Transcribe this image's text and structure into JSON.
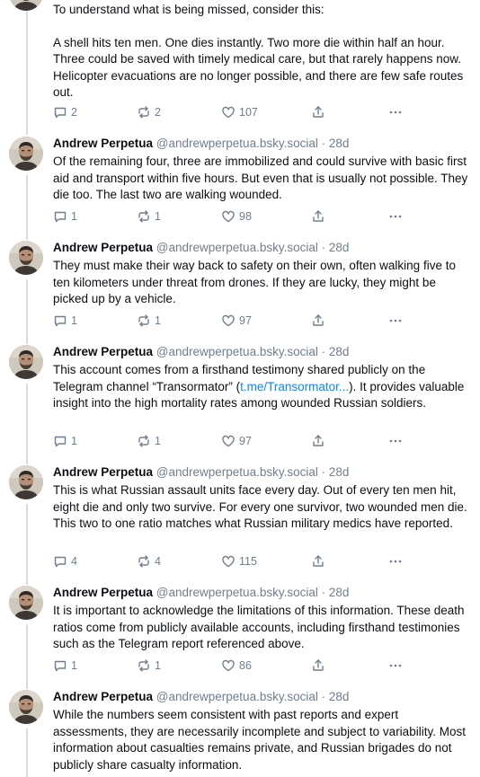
{
  "thread": {
    "first_post": {
      "text_1": "To understand what is being missed, consider this:",
      "text_2": "A shell hits ten men. One dies instantly. Two more die within half an hour. Three could be saved with timely medical care, but that rarely happens now. Helicopter evacuations are no longer possible, and there are few safe routes out.",
      "replies": "2",
      "reposts": "2",
      "likes": "107"
    },
    "author": {
      "name": "Andrew Perpetua",
      "handle": "@andrewperpetua.bsky.social",
      "separator": "·",
      "time": "28d"
    },
    "posts": [
      {
        "text": "Of the remaining four, three are immobilized and could survive with basic first aid and transport within five hours. But even that is usually not possible. They die too. The last two are walking wounded.",
        "replies": "1",
        "reposts": "1",
        "likes": "98"
      },
      {
        "text": "They must make their way back to safety on their own, often walking five to ten kilometers under threat from drones. If they are lucky, they might be picked up by a vehicle.",
        "replies": "1",
        "reposts": "1",
        "likes": "97"
      },
      {
        "text_before": "This account comes from a firsthand testimony shared publicly on the Telegram channel “Transormator” (",
        "link": "t.me/Transormator...",
        "text_after": "). It provides valuable insight into the high mortality rates among wounded Russian soldiers.",
        "replies": "1",
        "reposts": "1",
        "likes": "97"
      },
      {
        "text": "This is what Russian assault units face every day. Out of every ten men hit, eight die and only two survive. For every one survivor, two wounded men die. This two to one ratio matches what Russian military medics have reported.",
        "replies": "4",
        "reposts": "4",
        "likes": "115"
      },
      {
        "text": "It is important to acknowledge the limitations of this information. These death ratios come from publicly available accounts, including firsthand testimonies such as the Telegram report referenced above.",
        "replies": "1",
        "reposts": "1",
        "likes": "86"
      },
      {
        "text": "While the numbers seem consistent with past reports and expert assessments, they are necessarily incomplete and subject to variability. Most information about casualties remains private, and Russian brigades do not publicly share casualty information."
      }
    ]
  },
  "icons": {
    "reply": "reply-icon",
    "repost": "repost-icon",
    "like": "heart-icon",
    "share": "share-icon",
    "more": "more-icon"
  },
  "colors": {
    "text": "#0b0f14",
    "muted": "#6f7f8f",
    "link": "#1083fe",
    "thread_line": "#d4dbe2"
  }
}
